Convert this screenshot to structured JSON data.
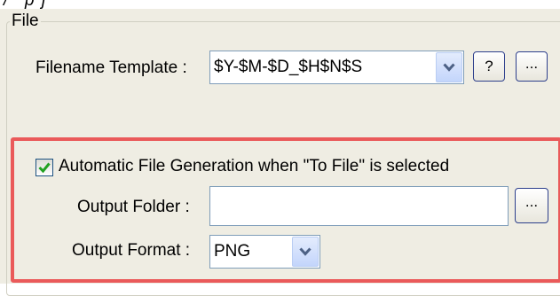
{
  "file_group": {
    "title": "File",
    "filename_template": {
      "label": "Filename Template :",
      "value": "$Y-$M-$D_$H$N$S",
      "help_button": "?",
      "browse_button": "..."
    },
    "auto_generation": {
      "checkbox_label": "Automatic File Generation when \"To File\" is selected",
      "checked": true,
      "output_folder": {
        "label": "Output Folder :",
        "value": "",
        "browse_button": "..."
      },
      "output_format": {
        "label": "Output Format :",
        "value": "PNG"
      }
    }
  },
  "icons": [
    "chevron-down-icon",
    "checkmark-icon"
  ],
  "colors": {
    "panel_background": "#efede3",
    "highlight_border": "#ea5a5a",
    "input_border": "#7f9db9",
    "button_border": "#2d3f8c",
    "checkmark": "#21a121"
  }
}
